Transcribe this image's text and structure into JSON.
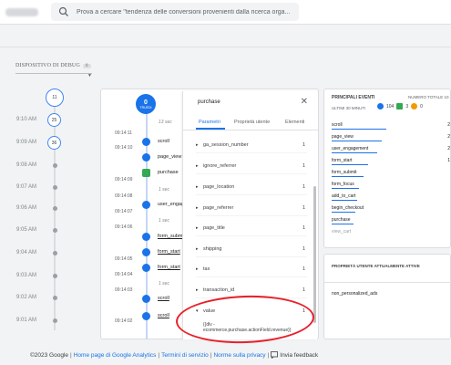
{
  "search": {
    "placeholder": "Prova a cercare \"tendenza delle conversioni provenienti dalla ricerca orga..."
  },
  "device": {
    "label": "DISPOSITIVO DI DEBUG",
    "count": "0"
  },
  "minutes": {
    "circle_counts": [
      "11",
      "25",
      "36"
    ],
    "times": [
      "9:10 AM",
      "9:09 AM",
      "9:08 AM",
      "9:07 AM",
      "9:06 AM",
      "9:05 AM",
      "9:04 AM",
      "9:03 AM",
      "9:02 AM",
      "9:01 AM"
    ]
  },
  "stream": {
    "badge_count": "0",
    "badge_label": "TRUEDI",
    "times": [
      "09:14:11",
      "09:14:10",
      "09:14:09",
      "09:14:08",
      "09:14:07",
      "09:14:06",
      "09:14:05",
      "09:14:04",
      "09:14:03",
      "09:14:02"
    ],
    "seconds": [
      "13 sec",
      "1 sec",
      "1 sec",
      "1 sec"
    ],
    "events": [
      "scroll",
      "page_view",
      "purchase",
      "user_engagem",
      "form_submit",
      "form_start",
      "form_start",
      "scroll",
      "scroll"
    ]
  },
  "detail": {
    "title": "purchase",
    "tabs": [
      "Parametri",
      "Proprietà utente",
      "Elementi"
    ],
    "params": [
      {
        "name": "ga_session_number",
        "count": "1"
      },
      {
        "name": "ignore_referrer",
        "count": "1"
      },
      {
        "name": "page_location",
        "count": "1"
      },
      {
        "name": "page_referrer",
        "count": "1"
      },
      {
        "name": "page_title",
        "count": "1"
      },
      {
        "name": "shipping",
        "count": "1"
      },
      {
        "name": "tax",
        "count": "1"
      },
      {
        "name": "transaction_id",
        "count": "1"
      },
      {
        "name": "value",
        "count": "1"
      }
    ],
    "value_text_1": "{{dlv -",
    "value_text_2": "ecommerce.purchase.actionField.revenue}}"
  },
  "top_events": {
    "title": "PRINCIPALI EVENTI",
    "total_label": "NUMERO TOTALE 10",
    "subtitle": "ULTIMI 30 MINUTI",
    "counts": [
      {
        "value": "104",
        "color": "#1a73e8"
      },
      {
        "value": "3",
        "color": "#34a853"
      },
      {
        "value": "0",
        "color": "#f29900"
      }
    ],
    "events": [
      {
        "name": "scroll",
        "count": "2"
      },
      {
        "name": "page_view",
        "count": "2"
      },
      {
        "name": "user_engagement",
        "count": "2"
      },
      {
        "name": "form_start",
        "count": "1"
      },
      {
        "name": "form_submit",
        "count": ""
      },
      {
        "name": "form_focus",
        "count": ""
      },
      {
        "name": "add_to_cart",
        "count": ""
      },
      {
        "name": "begin_checkout",
        "count": ""
      },
      {
        "name": "purchase",
        "count": ""
      },
      {
        "name": "view_cart",
        "count": ""
      }
    ]
  },
  "user_props": {
    "title": "PROPRIETÀ UTENTE ATTUALMENTE ATTIVE",
    "item": "non_personalized_ads"
  },
  "footer": {
    "copyright": "©2023 Google",
    "links": [
      "Home page di Google Analytics",
      "Termini di servizio",
      "Norme sulla privacy"
    ],
    "feedback": "Invia feedback"
  }
}
